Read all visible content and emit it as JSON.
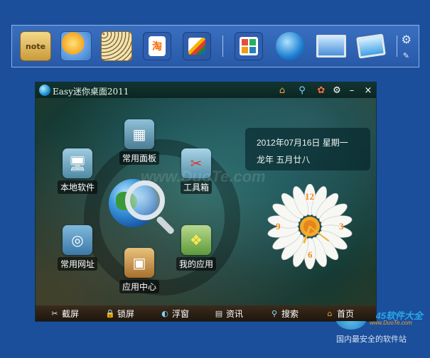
{
  "dock": {
    "items": [
      {
        "name": "notepad",
        "label": "note"
      },
      {
        "name": "weather",
        "label": ""
      },
      {
        "name": "dots",
        "label": ""
      },
      {
        "name": "taobao",
        "label": "淘"
      },
      {
        "name": "color-slash",
        "label": ""
      },
      {
        "name": "panel",
        "label": ""
      },
      {
        "name": "browser",
        "label": ""
      },
      {
        "name": "computer",
        "label": ""
      },
      {
        "name": "network-computer",
        "label": ""
      }
    ]
  },
  "window": {
    "title": "Easy迷你桌面2011",
    "controls": {
      "home": "home-icon",
      "search": "search-icon",
      "skin": "skin-icon",
      "settings": "gear-icon",
      "minimize": "–",
      "close": "×"
    }
  },
  "nodes": {
    "common_panel": "常用面板",
    "local_software": "本地软件",
    "toolbox": "工具箱",
    "common_sites": "常用网址",
    "my_apps": "我的应用",
    "app_center": "应用中心"
  },
  "watermark": "www.DuoTe.com",
  "date": {
    "gregorian": "2012年07月16日  星期一",
    "lunar": "龙年  五月廿八"
  },
  "clock": {
    "n12": "12",
    "n3": "3",
    "n6": "6",
    "n9": "9"
  },
  "bottom_bar": {
    "screenshot": "截屏",
    "lock": "锁屏",
    "float": "浮窗",
    "news": "资讯",
    "search": "搜索",
    "home": "首页"
  },
  "site": {
    "brand": "2345软件大全",
    "url": "www.DuoTe.com",
    "slogan": "国内最安全的软件站"
  }
}
